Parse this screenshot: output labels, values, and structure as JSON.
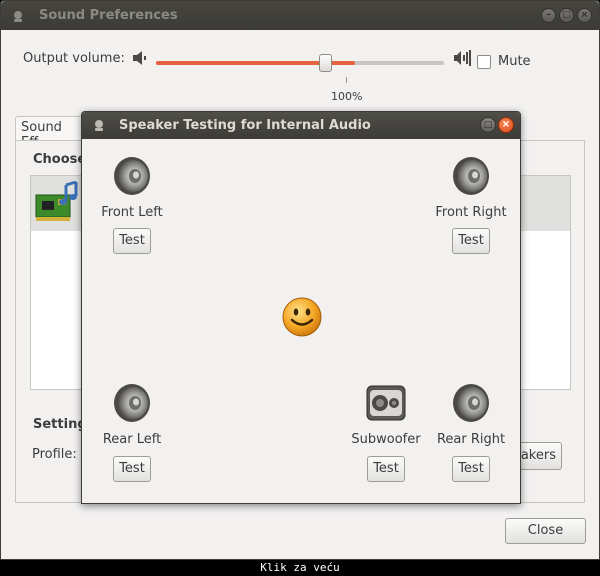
{
  "window": {
    "title": "Sound Preferences"
  },
  "output": {
    "label": "Output volume:",
    "volume_percent": 69,
    "value_label": "100%",
    "mute_label": "Mute",
    "mute_checked": false
  },
  "tab": {
    "label": "Sound Eff"
  },
  "panel": {
    "choose_label": "Choose",
    "settings_label": "Setting",
    "profile_label": "Profile:",
    "speakers_button": "akers",
    "close_button": "Close"
  },
  "dialog": {
    "title": "Speaker Testing for Internal Audio",
    "channels": [
      {
        "label": "Front Left",
        "test": "Test",
        "icon": "speaker-icon"
      },
      {
        "label": "Front Right",
        "test": "Test",
        "icon": "speaker-icon"
      },
      {
        "label": "Rear Left",
        "test": "Test",
        "icon": "speaker-icon"
      },
      {
        "label": "Subwoofer",
        "test": "Test",
        "icon": "subwoofer-icon"
      },
      {
        "label": "Rear Right",
        "test": "Test",
        "icon": "speaker-icon"
      }
    ]
  },
  "footer": {
    "caption": "Klik za veću"
  },
  "colors": {
    "accent": "#e5643e",
    "close": "#dd4814",
    "titlebar": "#3c3b37"
  }
}
